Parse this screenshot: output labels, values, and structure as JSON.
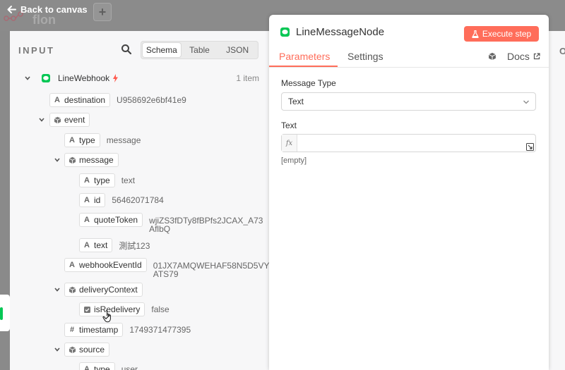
{
  "canvas": {
    "back_label": "Back to canvas",
    "ghost_title": "flon",
    "add_label": "+"
  },
  "input_panel": {
    "title": "INPUT",
    "view_modes": [
      "Schema",
      "Table",
      "JSON"
    ],
    "active_view": "Schema",
    "root_label": "LineWebhook",
    "item_count": "1 item"
  },
  "tree": {
    "destination": {
      "key": "destination",
      "value": "U958692e6bf41e9"
    },
    "event": {
      "key": "event"
    },
    "type": {
      "key": "type",
      "value": "message"
    },
    "message": {
      "key": "message"
    },
    "msg_type": {
      "key": "type",
      "value": "text"
    },
    "id": {
      "key": "id",
      "value": "56462071784"
    },
    "quoteToken": {
      "key": "quoteToken",
      "value_line1": "wjiZS3fDTy8fBPfs2JCAX_A73",
      "value_line2": "AflbQ"
    },
    "text": {
      "key": "text",
      "value": "測試123"
    },
    "webhookEventId": {
      "key": "webhookEventId",
      "value_line1": "01JX7AMQWEHAF58N5D5VY",
      "value_line2": "ATS79"
    },
    "deliveryContext": {
      "key": "deliveryContext"
    },
    "isRedelivery": {
      "key": "isRedelivery",
      "value": "false"
    },
    "timestamp": {
      "key": "timestamp",
      "value": "1749371477395"
    },
    "source": {
      "key": "source"
    },
    "src_type": {
      "key": "type",
      "value": "user"
    }
  },
  "node_panel": {
    "title": "LineMessageNode",
    "execute_label": "Execute step",
    "tabs": [
      "Parameters",
      "Settings"
    ],
    "docs_label": "Docs",
    "message_type_label": "Message Type",
    "message_type_value": "Text",
    "text_label": "Text",
    "fx_label": "fx",
    "text_placeholder": "",
    "empty_note": "[empty]"
  },
  "right_sliver_letter": "O",
  "colors": {
    "accent": "#ff6d5a",
    "line_green": "#06c755",
    "trigger_red": "#ff5a4e"
  }
}
